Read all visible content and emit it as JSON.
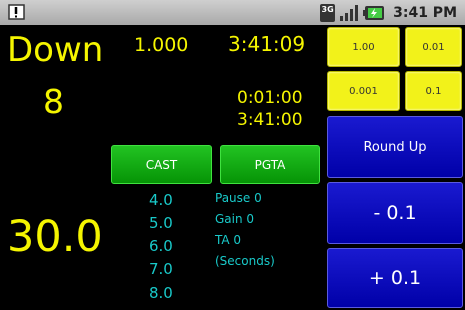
{
  "statusbar": {
    "network_label": "3G",
    "time": "3:41 PM"
  },
  "main": {
    "direction": "Down",
    "count": "8",
    "value": "30.0",
    "number": "1.000",
    "clock_time": "3:41:09",
    "elapsed": "0:01:00",
    "end_time": "3:41:00"
  },
  "buttons": {
    "cast": "CAST",
    "pgta": "PGTA",
    "step_1": "1.00",
    "step_001": "0.01",
    "step_0001": "0.001",
    "step_01": "0.1",
    "round_up": "Round Up",
    "minus": "-  0.1",
    "plus": "+  0.1"
  },
  "list": [
    "4.0",
    "5.0",
    "6.0",
    "7.0",
    "8.0"
  ],
  "info": {
    "pause": "Pause 0",
    "gain": "Gain 0",
    "ta": "TA 0",
    "seconds": "(Seconds)"
  },
  "colors": {
    "yellow_text": "#f5f500",
    "cyan_text": "#19c9c9",
    "yellow_button": "#f2f21a",
    "blue_button": "#0000c0",
    "green_button": "#14ad14"
  }
}
